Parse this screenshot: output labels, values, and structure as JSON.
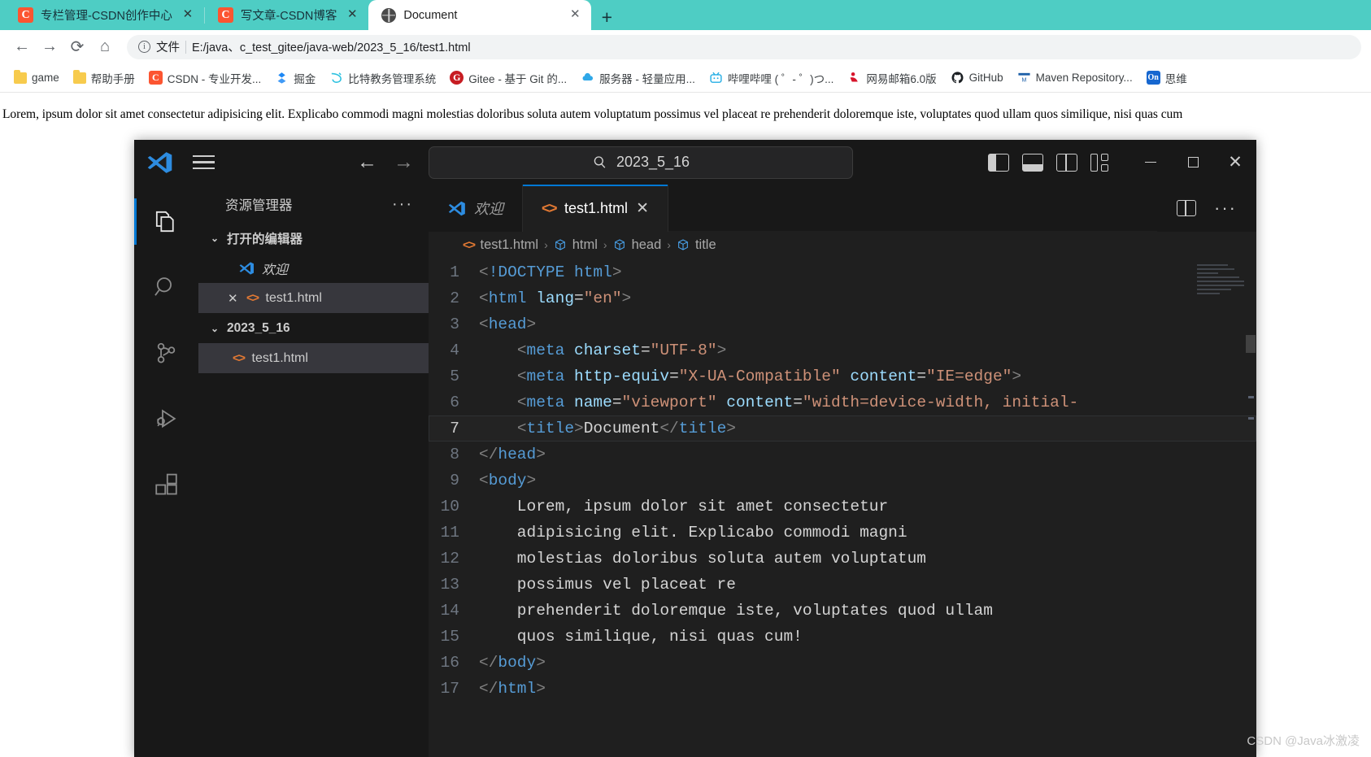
{
  "browser": {
    "tabs": [
      {
        "title": "专栏管理-CSDN创作中心",
        "icon": "csdn-icon",
        "active": false
      },
      {
        "title": "写文章-CSDN博客",
        "icon": "csdn-icon",
        "active": false
      },
      {
        "title": "Document",
        "icon": "globe-icon",
        "active": true
      }
    ],
    "new_tab_label": "+",
    "close_label": "✕",
    "toolbar": {
      "back": "←",
      "forward": "→",
      "reload": "⟳",
      "home": "⌂",
      "info": "ⓘ",
      "scheme_label": "文件",
      "url": "E:/java、c_test_gitee/java-web/2023_5_16/test1.html"
    },
    "bookmarks": [
      {
        "label": "game",
        "icon": "folder-icon"
      },
      {
        "label": "帮助手册",
        "icon": "folder-icon"
      },
      {
        "label": "CSDN - 专业开发...",
        "icon": "csdn-icon"
      },
      {
        "label": "掘金",
        "icon": "juejin-icon"
      },
      {
        "label": "比特教务管理系统",
        "icon": "bit-icon"
      },
      {
        "label": "Gitee - 基于 Git 的...",
        "icon": "gitee-icon"
      },
      {
        "label": "服务器 - 轻量应用...",
        "icon": "cloud-icon"
      },
      {
        "label": "哔哩哔哩 ( ゜- ゜)つ...",
        "icon": "bilibili-icon"
      },
      {
        "label": "网易邮箱6.0版",
        "icon": "netease-icon"
      },
      {
        "label": "GitHub",
        "icon": "github-icon"
      },
      {
        "label": "Maven Repository...",
        "icon": "maven-icon"
      },
      {
        "label": "思维",
        "icon": "on-icon"
      }
    ]
  },
  "page": {
    "body_text": "Lorem, ipsum dolor sit amet consectetur adipisicing elit. Explicabo commodi magni molestias doloribus soluta autem voluptatum possimus vel placeat re prehenderit doloremque iste, voluptates quod ullam quos similique, nisi quas cum"
  },
  "vscode": {
    "titlebar": {
      "search_value": "2023_5_16",
      "search_icon": "search-icon",
      "back": "←",
      "forward": "→",
      "minimize": "—",
      "maximize": "▢",
      "close": "✕"
    },
    "activity_bar": [
      {
        "name": "explorer",
        "active": true
      },
      {
        "name": "search",
        "active": false
      },
      {
        "name": "source-control",
        "active": false
      },
      {
        "name": "run-and-debug",
        "active": false
      },
      {
        "name": "extensions",
        "active": false
      }
    ],
    "sidebar": {
      "title": "资源管理器",
      "more_label": "···",
      "sections": [
        {
          "label": "打开的编辑器",
          "expanded_icon": "⌄",
          "items": [
            {
              "label": "欢迎",
              "icon": "vscode-icon",
              "italic": true,
              "selected": false,
              "close": ""
            },
            {
              "label": "test1.html",
              "icon": "html-icon",
              "italic": false,
              "selected": true,
              "close": "✕"
            }
          ]
        },
        {
          "label": "2023_5_16",
          "expanded_icon": "⌄",
          "items": [
            {
              "label": "test1.html",
              "icon": "html-icon",
              "italic": false,
              "selected": true,
              "close": ""
            }
          ]
        }
      ]
    },
    "tabs": [
      {
        "label": "欢迎",
        "icon": "vscode-icon",
        "active": false,
        "italic": true
      },
      {
        "label": "test1.html",
        "icon": "html-icon",
        "active": true,
        "italic": false,
        "close": "✕"
      }
    ],
    "tab_actions": {
      "split_editor": "split-editor-icon",
      "more": "···"
    },
    "breadcrumb": [
      {
        "label": "test1.html",
        "icon": "html-icon"
      },
      {
        "label": "html",
        "icon": "cube-icon"
      },
      {
        "label": "head",
        "icon": "cube-icon"
      },
      {
        "label": "title",
        "icon": "cube-icon"
      }
    ],
    "breadcrumb_separator": "›",
    "code": {
      "active_line": 7,
      "lines": [
        {
          "n": "1",
          "tokens": [
            {
              "t": "brk",
              "v": "<"
            },
            {
              "t": "tag",
              "v": "!DOCTYPE html"
            },
            {
              "t": "brk",
              "v": ">"
            }
          ]
        },
        {
          "n": "2",
          "tokens": [
            {
              "t": "brk",
              "v": "<"
            },
            {
              "t": "tag",
              "v": "html"
            },
            {
              "t": "txt",
              "v": " "
            },
            {
              "t": "attr",
              "v": "lang"
            },
            {
              "t": "eq",
              "v": "="
            },
            {
              "t": "str",
              "v": "\"en\""
            },
            {
              "t": "brk",
              "v": ">"
            }
          ]
        },
        {
          "n": "3",
          "tokens": [
            {
              "t": "brk",
              "v": "<"
            },
            {
              "t": "tag",
              "v": "head"
            },
            {
              "t": "brk",
              "v": ">"
            }
          ]
        },
        {
          "n": "4",
          "tokens": [
            {
              "t": "txt",
              "v": "    "
            },
            {
              "t": "brk",
              "v": "<"
            },
            {
              "t": "tag",
              "v": "meta"
            },
            {
              "t": "txt",
              "v": " "
            },
            {
              "t": "attr",
              "v": "charset"
            },
            {
              "t": "eq",
              "v": "="
            },
            {
              "t": "str",
              "v": "\"UTF-8\""
            },
            {
              "t": "brk",
              "v": ">"
            }
          ]
        },
        {
          "n": "5",
          "tokens": [
            {
              "t": "txt",
              "v": "    "
            },
            {
              "t": "brk",
              "v": "<"
            },
            {
              "t": "tag",
              "v": "meta"
            },
            {
              "t": "txt",
              "v": " "
            },
            {
              "t": "attr",
              "v": "http-equiv"
            },
            {
              "t": "eq",
              "v": "="
            },
            {
              "t": "str",
              "v": "\"X-UA-Compatible\""
            },
            {
              "t": "txt",
              "v": " "
            },
            {
              "t": "attr",
              "v": "content"
            },
            {
              "t": "eq",
              "v": "="
            },
            {
              "t": "str",
              "v": "\"IE=edge\""
            },
            {
              "t": "brk",
              "v": ">"
            }
          ]
        },
        {
          "n": "6",
          "tokens": [
            {
              "t": "txt",
              "v": "    "
            },
            {
              "t": "brk",
              "v": "<"
            },
            {
              "t": "tag",
              "v": "meta"
            },
            {
              "t": "txt",
              "v": " "
            },
            {
              "t": "attr",
              "v": "name"
            },
            {
              "t": "eq",
              "v": "="
            },
            {
              "t": "str",
              "v": "\"viewport\""
            },
            {
              "t": "txt",
              "v": " "
            },
            {
              "t": "attr",
              "v": "content"
            },
            {
              "t": "eq",
              "v": "="
            },
            {
              "t": "str",
              "v": "\"width=device-width, initial-"
            }
          ]
        },
        {
          "n": "7",
          "tokens": [
            {
              "t": "txt",
              "v": "    "
            },
            {
              "t": "brk",
              "v": "<"
            },
            {
              "t": "tag",
              "v": "title"
            },
            {
              "t": "brk",
              "v": ">"
            },
            {
              "t": "txt",
              "v": "Document"
            },
            {
              "t": "brk",
              "v": "</"
            },
            {
              "t": "tag",
              "v": "title"
            },
            {
              "t": "brk",
              "v": ">"
            }
          ]
        },
        {
          "n": "8",
          "tokens": [
            {
              "t": "brk",
              "v": "</"
            },
            {
              "t": "tag",
              "v": "head"
            },
            {
              "t": "brk",
              "v": ">"
            }
          ]
        },
        {
          "n": "9",
          "tokens": [
            {
              "t": "brk",
              "v": "<"
            },
            {
              "t": "tag",
              "v": "body"
            },
            {
              "t": "brk",
              "v": ">"
            }
          ]
        },
        {
          "n": "10",
          "tokens": [
            {
              "t": "txt",
              "v": "    Lorem, ipsum dolor sit amet consectetur"
            }
          ]
        },
        {
          "n": "11",
          "tokens": [
            {
              "t": "txt",
              "v": "    adipisicing elit. Explicabo commodi magni"
            }
          ]
        },
        {
          "n": "12",
          "tokens": [
            {
              "t": "txt",
              "v": "    molestias doloribus soluta autem voluptatum"
            }
          ]
        },
        {
          "n": "13",
          "tokens": [
            {
              "t": "txt",
              "v": "    possimus vel placeat re"
            }
          ]
        },
        {
          "n": "14",
          "tokens": [
            {
              "t": "txt",
              "v": "    prehenderit doloremque iste, voluptates quod ullam"
            }
          ]
        },
        {
          "n": "15",
          "tokens": [
            {
              "t": "txt",
              "v": "    quos similique, nisi quas cum!"
            }
          ]
        },
        {
          "n": "16",
          "tokens": [
            {
              "t": "brk",
              "v": "</"
            },
            {
              "t": "tag",
              "v": "body"
            },
            {
              "t": "brk",
              "v": ">"
            }
          ]
        },
        {
          "n": "17",
          "tokens": [
            {
              "t": "brk",
              "v": "</"
            },
            {
              "t": "tag",
              "v": "html"
            },
            {
              "t": "brk",
              "v": ">"
            }
          ]
        }
      ]
    }
  },
  "watermark": "CSDN @Java冰激凌",
  "colors": {
    "browser_tabstrip": "#4ecdc4",
    "vscode_bg": "#1e1e1e",
    "vscode_chrome": "#181818",
    "accent_blue": "#0078d4",
    "tag_blue": "#569cd6",
    "attr_blue": "#9cdcfe",
    "string_orange": "#ce9178",
    "html_icon_orange": "#e37933",
    "csdn_red": "#fc5531"
  }
}
